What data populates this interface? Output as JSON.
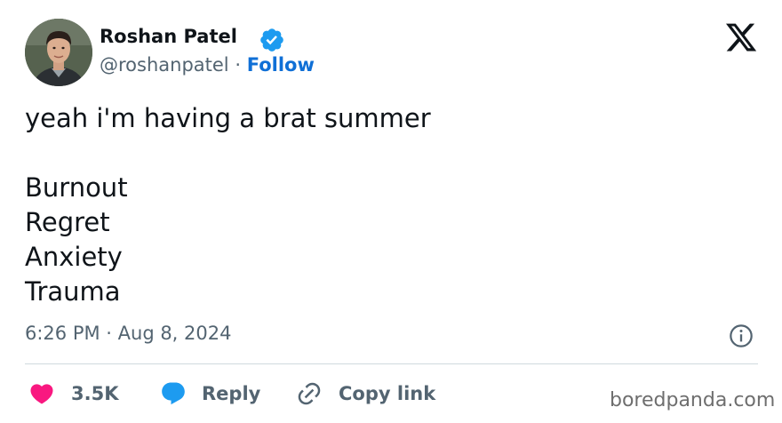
{
  "author": {
    "name": "Roshan Patel",
    "handle": "@roshanpatel",
    "separator": "·",
    "follow_label": "Follow",
    "verified": true,
    "verified_color": "#1d9bf0"
  },
  "tweet": {
    "lines": [
      "yeah i'm having a brat summer",
      "",
      "Burnout",
      "Regret",
      "Anxiety",
      "Trauma"
    ],
    "timestamp": "6:26 PM · Aug 8, 2024"
  },
  "actions": {
    "like_count": "3.5K",
    "reply_label": "Reply",
    "copy_link_label": "Copy link",
    "like_color": "#f91880",
    "reply_color": "#1d9bf0"
  },
  "icons": {
    "platform": "x-logo-icon",
    "info": "info-icon",
    "like": "heart-icon",
    "reply": "speech-bubble-icon",
    "copy": "link-icon"
  },
  "watermark": "boredpanda.com"
}
